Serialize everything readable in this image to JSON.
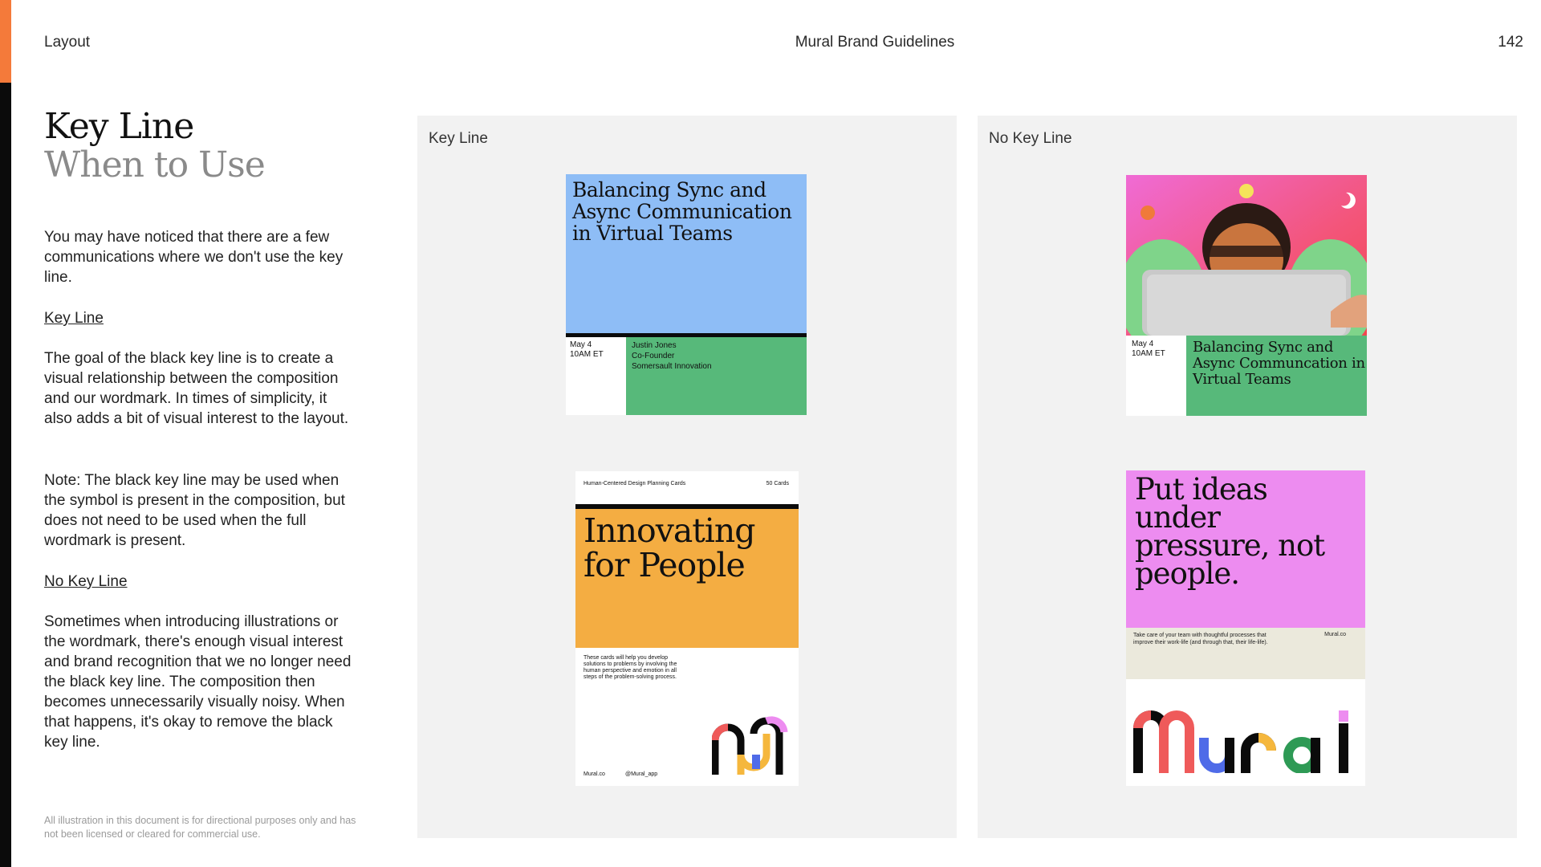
{
  "header": {
    "section": "Layout",
    "doc_title": "Mural Brand Guidelines",
    "page_number": "142"
  },
  "title": {
    "line1": "Key Line",
    "line2": "When to Use"
  },
  "body": {
    "intro": "You may have noticed that there are a few communications where we don't use the key line.",
    "key_line_heading": "Key Line",
    "key_line_text": "The goal of the black key line is to create a visual relationship between the composition and our wordmark. In times of simplicity, it also adds a bit of visual interest to the layout.",
    "note": "Note: The black key line may be used when the symbol is present in the composition, but does not need to be used when the full wordmark is present.",
    "no_key_line_heading": "No Key Line",
    "no_key_line_text": "Sometimes when introducing illustrations or the wordmark, there's enough visual interest and brand recognition that we no longer need the black key line. The composition then becomes unnecessarily visually noisy. When that happens, it's okay to remove the black key line."
  },
  "footnote": "All illustration in this document is for directional purposes only and has not been licensed or cleared for commercial use.",
  "panels": {
    "key_line_label": "Key Line",
    "no_key_line_label": "No Key Line"
  },
  "card_event": {
    "title": "Balancing Sync and Async Communication in Virtual Teams",
    "date": "May 4",
    "time": "10AM ET",
    "speaker": "Justin Jones",
    "role": "Co-Founder",
    "company": "Somersault Innovation"
  },
  "card_deck": {
    "top_left": "Human-Centered Design Planning Cards",
    "top_right": "50 Cards",
    "title": "Innovating for People",
    "description": "These cards will help you develop solutions to problems by involving the human perspective and emotion in all steps of the problem-solving process.",
    "site": "Mural.co",
    "handle": "@Mural_app"
  },
  "card_illustrated": {
    "date": "May 4",
    "time": "10AM ET",
    "title": "Balancing Sync and Async Communcation in Virtual Teams"
  },
  "card_wordmark": {
    "title": "Put ideas under pressure, not people.",
    "text": "Take care of your team with thoughtful processes that improve their work-life (and through that, their life-life).",
    "site": "Mural.co"
  },
  "colors": {
    "orange": "#f47a3a",
    "blue": "#8ebdf6",
    "green": "#57b97a",
    "yellow_orange": "#f4ad42",
    "pink": "#ed8cf0",
    "cream": "#ebe9dc",
    "mural_red": "#ef5a5a",
    "mural_blue": "#4f6be8",
    "mural_yellow": "#f5b73d",
    "mural_green": "#2e9a55"
  }
}
